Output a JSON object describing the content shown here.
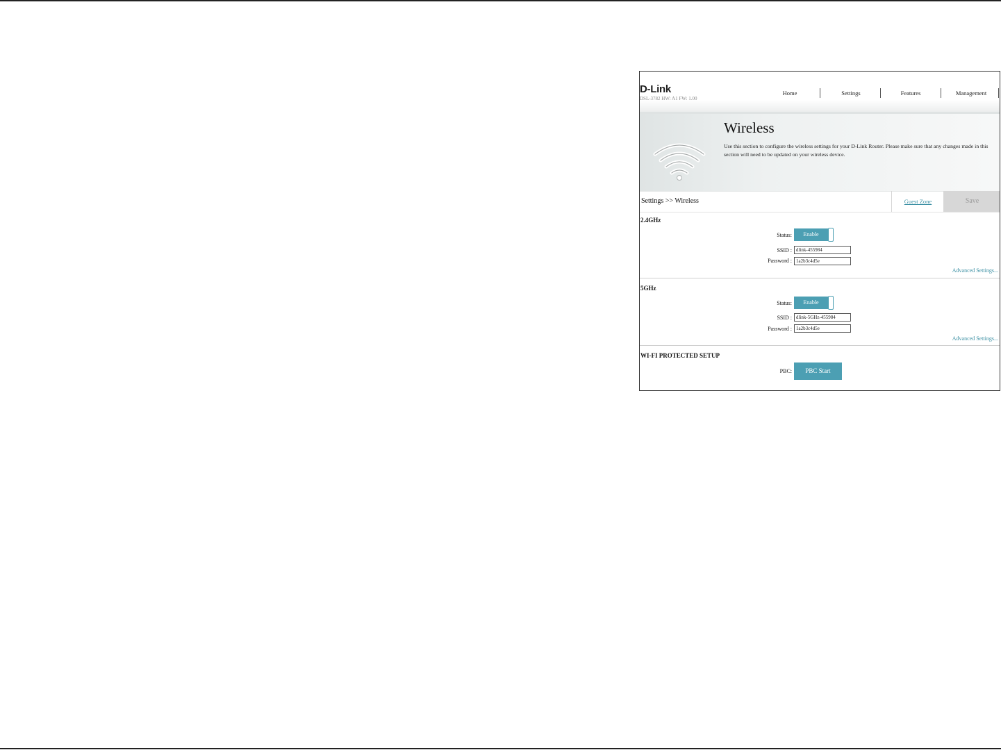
{
  "header": {
    "logo": "D-Link",
    "model_info": "DSL-3782  HW: A1  FW: 1.00",
    "nav": [
      "Home",
      "Settings",
      "Features",
      "Management"
    ]
  },
  "banner": {
    "title": "Wireless",
    "description": "Use this section to configure the wireless settings for your D-Link Router. Please make sure that any changes made in this section will need to be updated on your wireless device."
  },
  "breadcrumb": "Settings >> Wireless",
  "actions": {
    "guest_zone": "Guest Zone",
    "save": "Save"
  },
  "band_24": {
    "title": "2.4GHz",
    "status_label": "Status:",
    "status_value": "Enable",
    "ssid_label": "SSID :",
    "ssid_value": "dlink-455984",
    "password_label": "Password :",
    "password_value": "1a2b3c4d5e",
    "advanced_link": "Advanced Settings..."
  },
  "band_5": {
    "title": "5GHz",
    "status_label": "Status:",
    "status_value": "Enable",
    "ssid_label": "SSID :",
    "ssid_value": "dlink-5GHz-455984",
    "password_label": "Password :",
    "password_value": "1a2b3c4d5e",
    "advanced_link": "Advanced Settings..."
  },
  "wps": {
    "title": "WI-FI PROTECTED SETUP",
    "pbc_label": "PBC:",
    "pbc_button": "PBC Start"
  },
  "colors": {
    "accent": "#4c9fb3",
    "link": "#3a8fa3",
    "save_disabled_bg": "#d7d7d7"
  }
}
